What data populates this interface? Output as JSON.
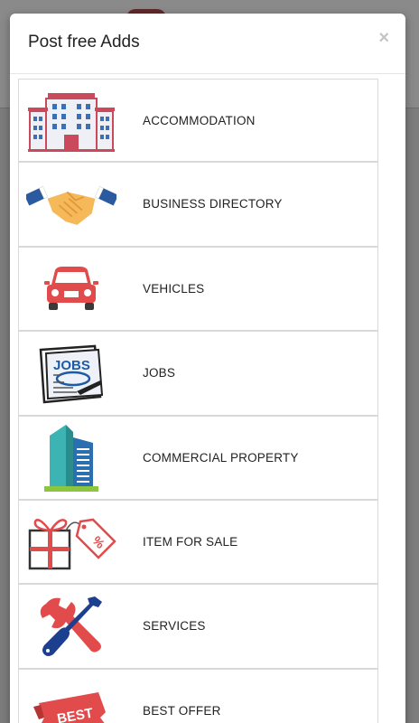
{
  "modal": {
    "title": "Post free Adds",
    "close_label": "×"
  },
  "categories": [
    {
      "label": "ACCOMMODATION",
      "icon": "building-icon"
    },
    {
      "label": "BUSINESS DIRECTORY",
      "icon": "handshake-icon"
    },
    {
      "label": "VEHICLES",
      "icon": "car-icon"
    },
    {
      "label": "JOBS",
      "icon": "jobs-newspaper-icon"
    },
    {
      "label": "COMMERCIAL PROPERTY",
      "icon": "skyscraper-icon"
    },
    {
      "label": "ITEM FOR SALE",
      "icon": "gift-tag-icon"
    },
    {
      "label": "SERVICES",
      "icon": "tools-icon"
    },
    {
      "label": "BEST OFFER",
      "icon": "best-ribbon-icon"
    }
  ],
  "icon_text": {
    "jobs": "JOBS",
    "tag": "%",
    "best": "BEST"
  },
  "colors": {
    "overlay": "#7d7d7d",
    "border": "#d9d9d9",
    "accent_red": "#e14b4b"
  }
}
